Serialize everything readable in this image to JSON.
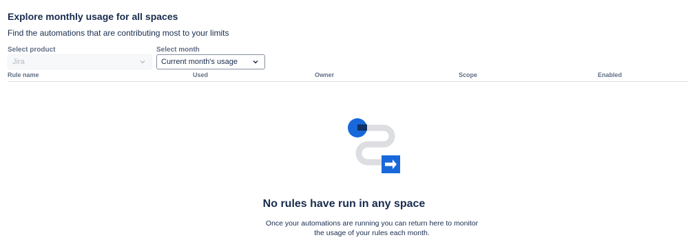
{
  "header": {
    "title": "Explore monthly usage for all spaces",
    "subtitle": "Find the automations that are contributing most to your limits"
  },
  "filters": {
    "product": {
      "label": "Select product",
      "value": "Jira",
      "disabled": true
    },
    "month": {
      "label": "Select month",
      "value": "Current month's usage"
    }
  },
  "table": {
    "columns": [
      "Rule name",
      "Used",
      "Owner",
      "Scope",
      "Enabled"
    ]
  },
  "empty_state": {
    "illustration": "rule-path-illustration",
    "title": "No rules have run in any space",
    "description": "Once your automations are running you can return here to monitor the usage of your rules each month."
  },
  "colors": {
    "accent_blue": "#1868db",
    "dark_blue": "#123263",
    "path_gray": "#dddee1",
    "text": "#172b4d",
    "subtle_text": "#626f86"
  }
}
